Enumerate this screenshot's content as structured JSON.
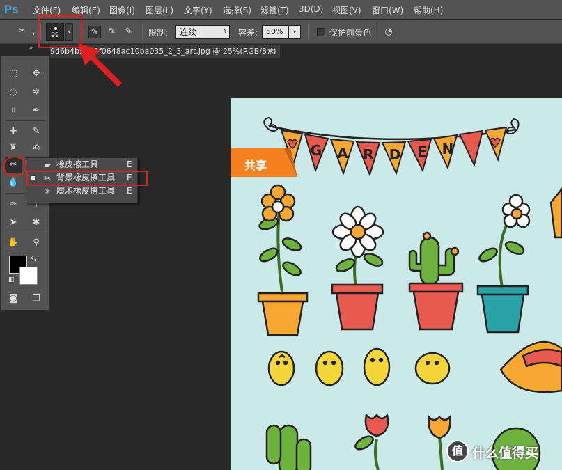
{
  "app": {
    "logo": "Ps"
  },
  "menu": [
    {
      "label": "文件(F)"
    },
    {
      "label": "编辑(E)"
    },
    {
      "label": "图像(I)"
    },
    {
      "label": "图层(L)"
    },
    {
      "label": "文字(Y)"
    },
    {
      "label": "选择(S)"
    },
    {
      "label": "滤镜(T)"
    },
    {
      "label": "3D(D)"
    },
    {
      "label": "视图(V)"
    },
    {
      "label": "窗口(W)"
    },
    {
      "label": "帮助(H)"
    }
  ],
  "options": {
    "brush_size": "99",
    "limit_label": "限制:",
    "limit_value": "连续",
    "tolerance_label": "容差:",
    "tolerance_value": "50%",
    "protect_fg_label": "保护前景色"
  },
  "document_tab": {
    "title": "9d6b4b9079f0648ac10ba035_2_3_art.jpg @ 25%(RGB/8#)",
    "close": "×"
  },
  "flyout": [
    {
      "label": "橡皮擦工具",
      "shortcut": "E",
      "icon": "eraser-icon",
      "selected": false
    },
    {
      "label": "背景橡皮擦工具",
      "shortcut": "E",
      "icon": "background-eraser-icon",
      "selected": true
    },
    {
      "label": "魔术橡皮擦工具",
      "shortcut": "E",
      "icon": "magic-eraser-icon",
      "selected": false
    }
  ],
  "canvas": {
    "badge": "共享",
    "banner_letters": [
      "G",
      "A",
      "R",
      "D",
      "E",
      "N"
    ]
  },
  "watermark": {
    "logo": "值",
    "text": "什么值得买"
  },
  "colors": {
    "annotation_red": "#e02020",
    "canvas_bg": "#cce9e9",
    "share_orange": "#f5821f",
    "pot_orange": "#f6a833",
    "pot_red": "#e85a4f",
    "pot_teal": "#2aa3a8",
    "chick_yellow": "#f5d63a",
    "leaf_green": "#6fb33f"
  }
}
